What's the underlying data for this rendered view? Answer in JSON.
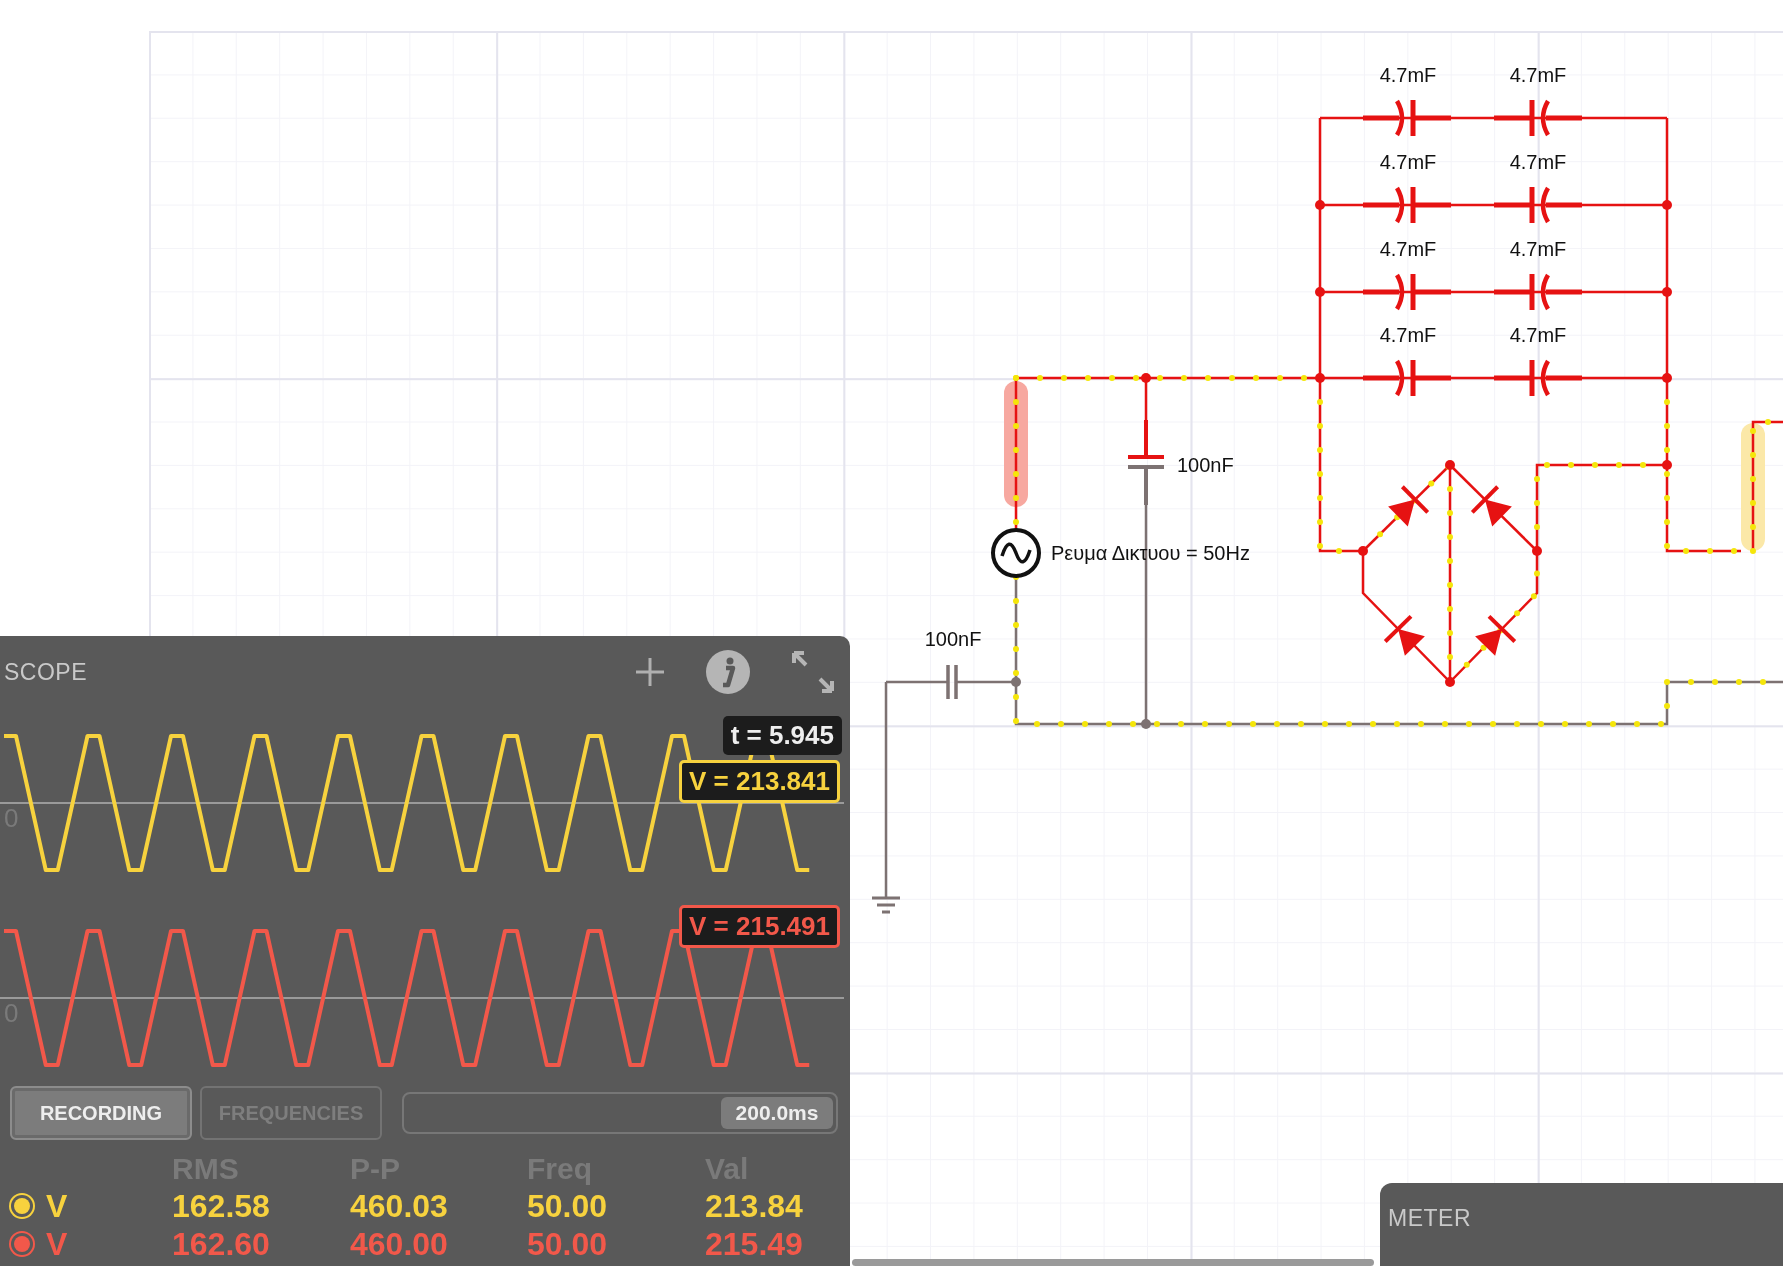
{
  "circuit": {
    "capacitor_bank": [
      {
        "left_label": "4.7mF",
        "right_label": "4.7mF"
      },
      {
        "left_label": "4.7mF",
        "right_label": "4.7mF"
      },
      {
        "left_label": "4.7mF",
        "right_label": "4.7mF"
      },
      {
        "left_label": "4.7mF",
        "right_label": "4.7mF"
      }
    ],
    "filter_capacitor_label": "100nF",
    "input_capacitor_label": "100nF",
    "source_label": "Ρευμα Δικτυου = 50Hz"
  },
  "scope": {
    "title": "SCOPE",
    "time_readout": "t = 5.945",
    "traces": [
      {
        "zero_label": "0",
        "readout": "V = 213.841",
        "color": "#f7d23e"
      },
      {
        "zero_label": "0",
        "readout": "V = 215.491",
        "color": "#f2584a"
      }
    ],
    "tabs": [
      {
        "label": "RECORDING",
        "selected": true
      },
      {
        "label": "FREQUENCIES",
        "selected": false
      }
    ],
    "timescale": {
      "reading": "200.0ms",
      "level": 1
    },
    "columns": [
      "RMS",
      "P-P",
      "Freq",
      "Val"
    ],
    "rows": [
      {
        "name": "V",
        "color": "#f7d23e",
        "values": [
          "162.58",
          "460.03",
          "50.00",
          "213.84"
        ]
      },
      {
        "name": "V",
        "color": "#f2584a",
        "values": [
          "162.60",
          "460.00",
          "50.00",
          "215.49"
        ]
      }
    ]
  },
  "meter": {
    "title": "METER"
  }
}
